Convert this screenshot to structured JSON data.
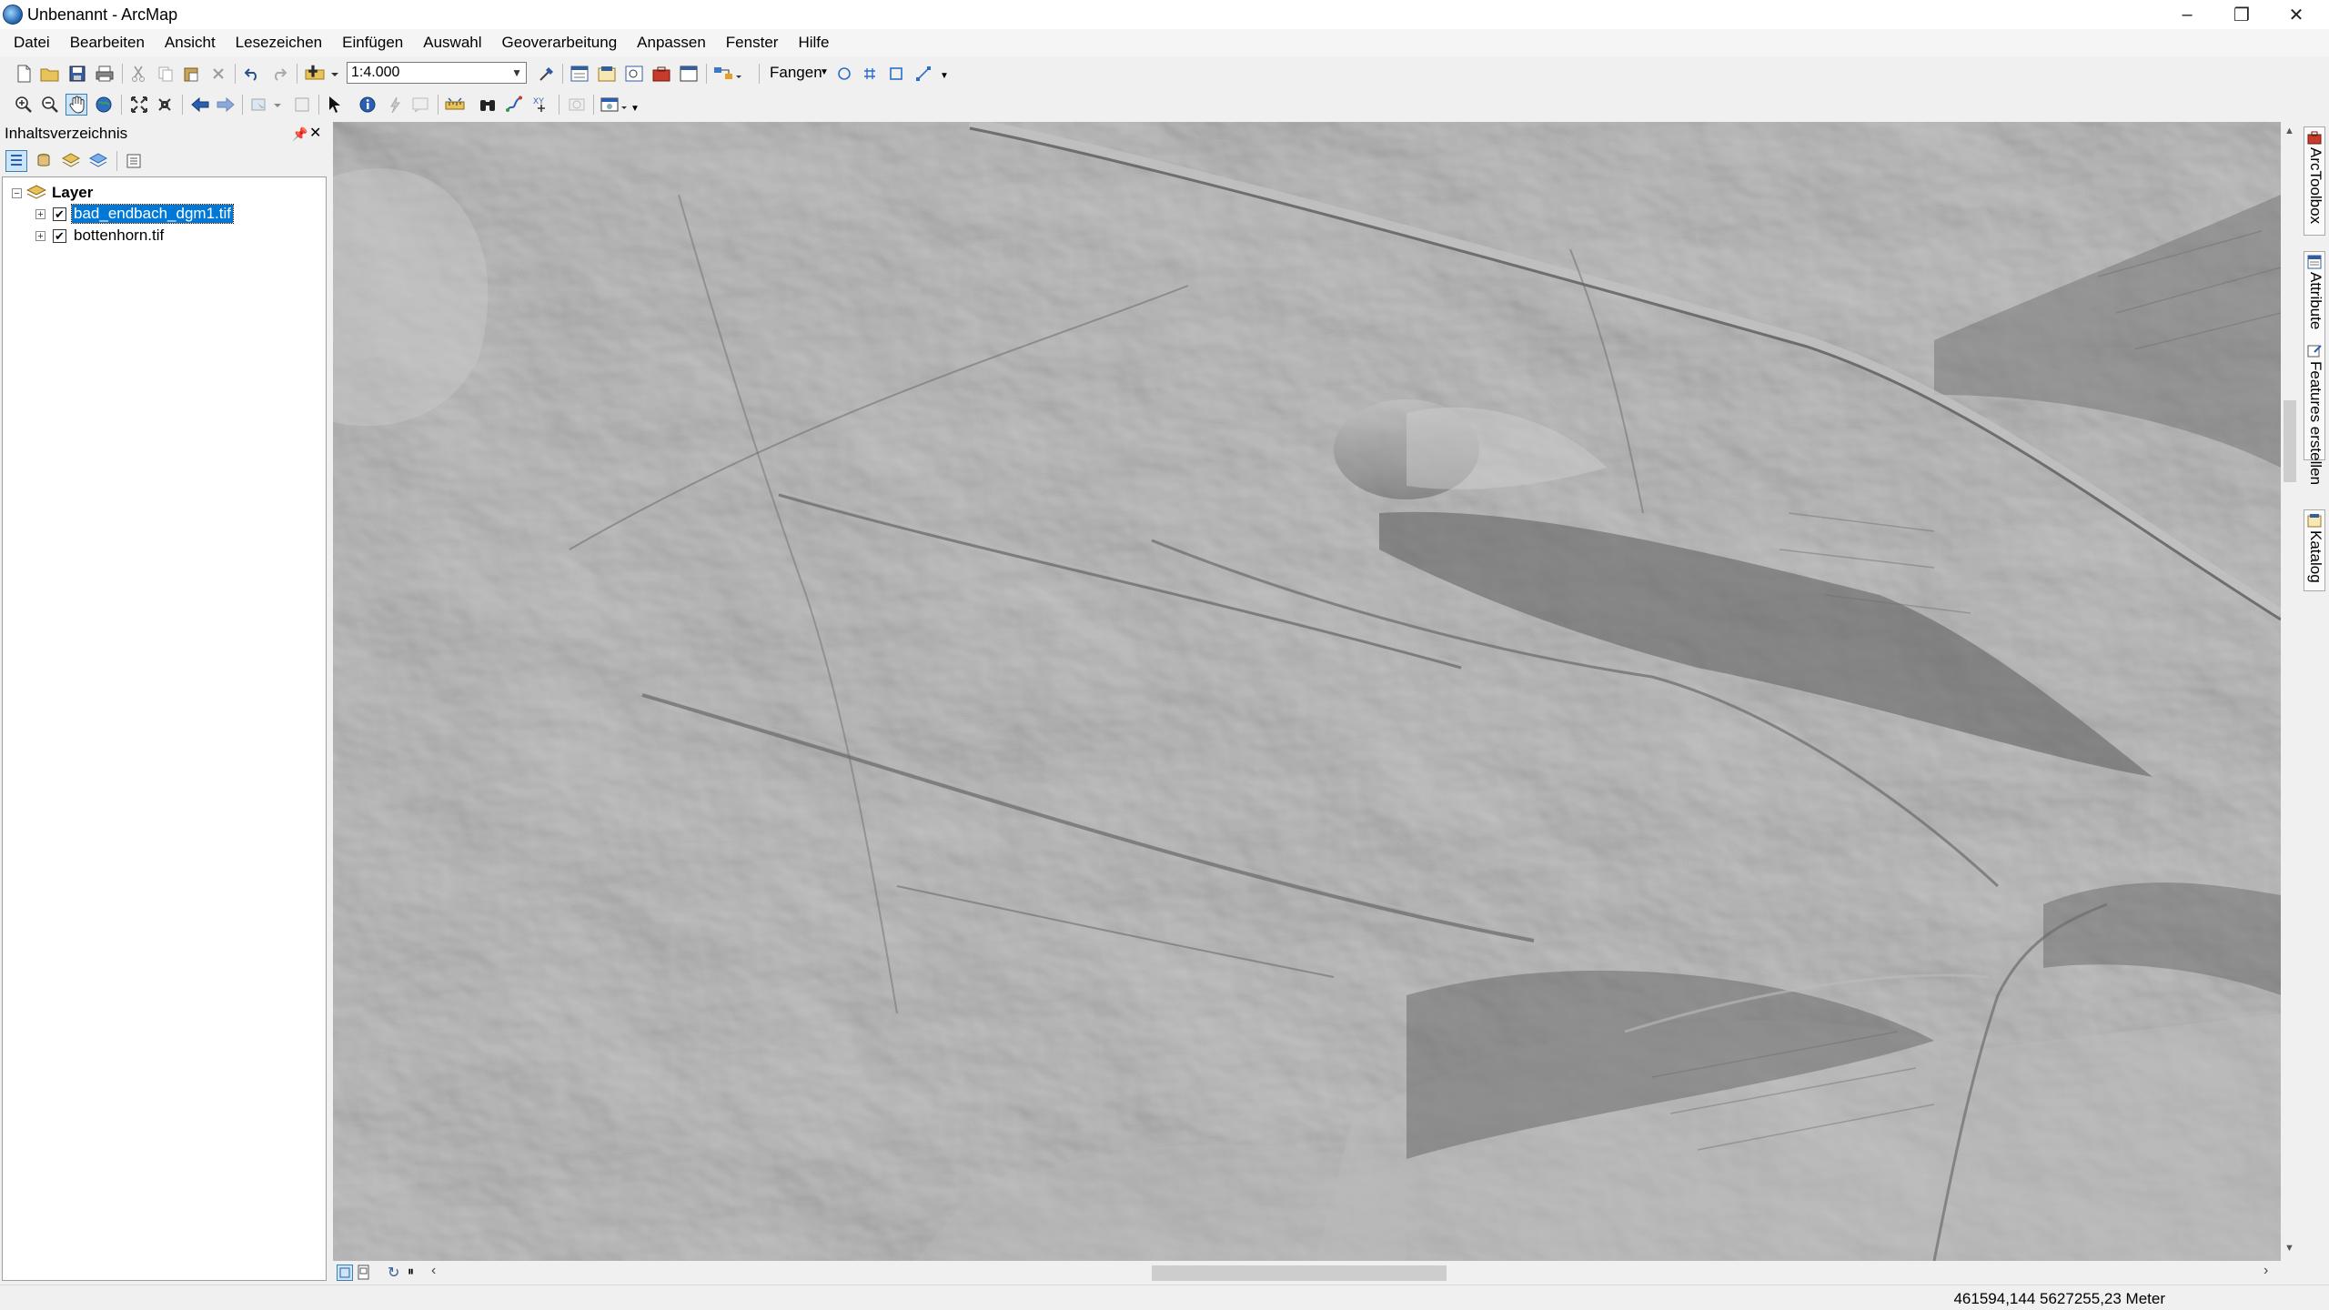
{
  "window": {
    "title": "Unbenannt - ArcMap",
    "minimize": "–",
    "restore": "❐",
    "close": "✕"
  },
  "menu": [
    "Datei",
    "Bearbeiten",
    "Ansicht",
    "Lesezeichen",
    "Einfügen",
    "Auswahl",
    "Geoverarbeitung",
    "Anpassen",
    "Fenster",
    "Hilfe"
  ],
  "standard_toolbar": {
    "scale": "1:4.000",
    "snapping_label": "Fangen"
  },
  "toc": {
    "title": "Inhaltsverzeichnis",
    "pin": "𝟰",
    "close": "✕",
    "group": {
      "label": "Layer",
      "expanded": true
    },
    "layers": [
      {
        "name": "bad_endbach_dgm1.tif",
        "checked": true,
        "selected": true
      },
      {
        "name": "bottenhorn.tif",
        "checked": true,
        "selected": false
      }
    ]
  },
  "right_dock": [
    "ArcToolbox",
    "Attribute",
    "Features erstellen",
    "Katalog"
  ],
  "status": {
    "coordinates": "461594,144  5627255,23 Meter"
  },
  "colors": {
    "selection": "#0078d7",
    "hillshade_base": "#8e8e8e"
  }
}
